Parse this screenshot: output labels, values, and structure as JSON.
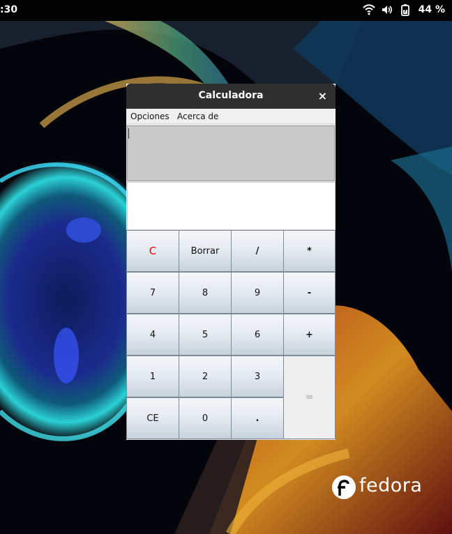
{
  "topbar": {
    "clock": ":30",
    "battery_percent": "44 %",
    "icons": [
      "wifi-icon",
      "volume-icon",
      "battery-icon"
    ]
  },
  "window": {
    "title": "Calculadora",
    "close_label": "×",
    "menu": [
      "Opciones",
      "Acerca de"
    ],
    "display_top": "",
    "display_bottom": ""
  },
  "keys": [
    [
      "C",
      "Borrar",
      "/",
      "*"
    ],
    [
      "7",
      "8",
      "9",
      "-"
    ],
    [
      "4",
      "5",
      "6",
      "+"
    ],
    [
      "1",
      "2",
      "3",
      "="
    ],
    [
      "CE",
      "0",
      "."
    ]
  ],
  "desktop": {
    "logo_text": "fedora"
  },
  "colors": {
    "clear_key": "#e00000",
    "titlebar": "#2f2f2f",
    "display": "#c9c9c9"
  }
}
